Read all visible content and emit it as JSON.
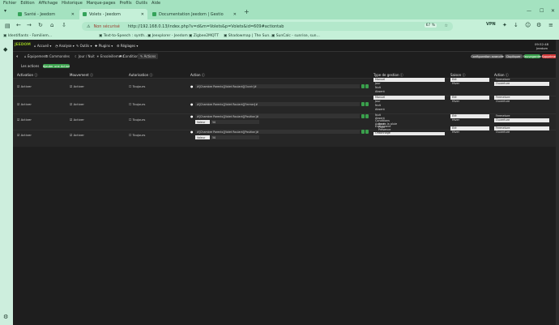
{
  "browser": {
    "menu": [
      "Fichier",
      "Edition",
      "Affichage",
      "Historique",
      "Marque-pages",
      "Profils",
      "Outils",
      "Aide"
    ],
    "tabs": [
      {
        "label": "Santé - Jeedom",
        "active": false
      },
      {
        "label": "Volets - Jeedom",
        "active": true
      },
      {
        "label": "Documentation Jeedom | Gestio",
        "active": false
      }
    ],
    "security": "Non sécurisé",
    "url": "http://192.168.0.13/index.php?v=d&m=Volets&p=Volets&id=609#actiontab",
    "zoom": "67 %",
    "vpn": "VPN",
    "bookmarks": [
      "Identifiants - Familiem...",
      "Text-to-Speech : synth...",
      "Jeexplorer - Jeedom",
      "Zigbee2MQTT",
      "Shadowmap | The Sun...",
      "SunCalc - sunrise, sun..."
    ]
  },
  "app": {
    "logo": "JEEDOM",
    "menu": [
      "Accueil",
      "Analyse",
      "Outils",
      "Plugins",
      "Réglages"
    ],
    "time": "09:52:48",
    "user": "Jeedom",
    "buttons": {
      "advanced": "Configuration avancée",
      "duplicate": "Dupliquer",
      "save": "Sauvegarder",
      "delete": "Supprimer"
    },
    "subtabs": [
      "Équipement",
      "Commandes",
      "Jour / Nuit",
      "Ensoleillement",
      "Conditions",
      "Actions"
    ],
    "actions_label": "Les actions",
    "add_action": "Ajouter une Action"
  },
  "table": {
    "headers": [
      "Activation",
      "Mouvement",
      "Autorisation",
      "Action",
      "Type de gestion",
      "Saison",
      "Action"
    ],
    "rows": [
      {
        "activation": "Activer",
        "mouvement": "Activer",
        "autorisation": "Toujours",
        "action": "#[Chambre Parents][Volet Roulant][Ouvrir]#",
        "value_label": "",
        "value": "",
        "gestion": [
          "Manuel",
          "Jour",
          "Nuit",
          "Absent"
        ],
        "gestion_selected": 0,
        "saison": [
          "Eté",
          "Hiver"
        ],
        "etat": [
          "Fermeture",
          "Ouverture"
        ]
      },
      {
        "activation": "Activer",
        "mouvement": "Activer",
        "autorisation": "Toujours",
        "action": "#[Chambre Parents][Volet Roulant][Fermer]#",
        "value_label": "",
        "value": "",
        "gestion": [
          "Manuel",
          "Jour",
          "Nuit",
          "Absent"
        ],
        "gestion_selected": 0,
        "saison": [
          "Eté",
          "Hiver"
        ],
        "etat": [
          "Fermeture",
          "Ouverture"
        ]
      },
      {
        "activation": "Activer",
        "mouvement": "Activer",
        "autorisation": "Toujours",
        "action": "#[Chambre Parents][Volet Roulant][Position]#",
        "value_label": "Valeur",
        "value": "50",
        "gestion": [
          "Nuit",
          "Absent",
          "Conditions",
          "Azimut",
          "Evènement",
          "Ordre",
          "Apres la pluie",
          "Pluie",
          "Présence"
        ],
        "gestion_selected": 4,
        "saison": [
          "Eté",
          "Hiver"
        ],
        "etat": [
          "Fermeture",
          "Ouverture"
        ]
      },
      {
        "activation": "Activer",
        "mouvement": "Activer",
        "autorisation": "Toujours",
        "action": "#[Chambre Parents][Volet Roulant][Position]#",
        "value_label": "Valeur",
        "value": "50",
        "gestion": [
          "Azimut",
          "Evènement",
          "Apres la pluie",
          "Pluie",
          "Présence",
          "Ordonnage"
        ],
        "gestion_selected": 1,
        "saison": [
          "Eté",
          "Hiver"
        ],
        "etat": [
          "Fermeture",
          "Ouverture"
        ]
      }
    ]
  }
}
